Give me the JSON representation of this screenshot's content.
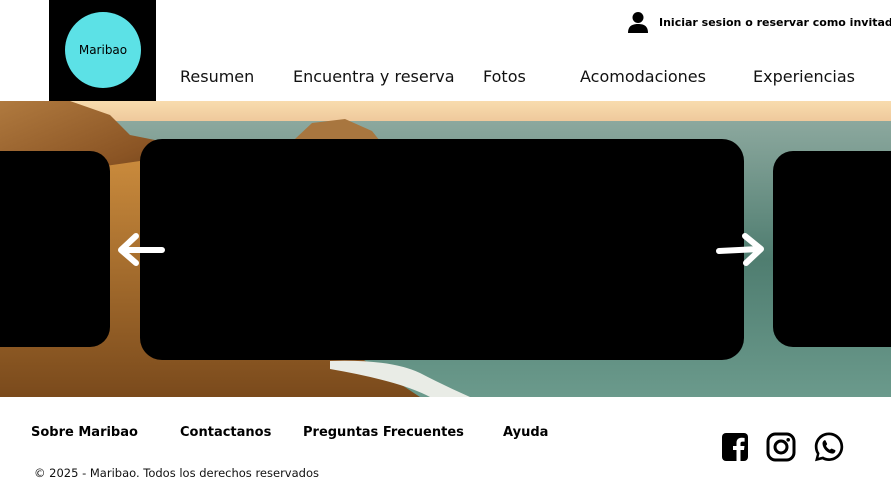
{
  "header": {
    "logo_text": "Maribao",
    "login_label": "Iniciar sesion o reservar como invitado",
    "nav": [
      {
        "label": "Resumen"
      },
      {
        "label": "Encuentra y reserva"
      },
      {
        "label": "Fotos"
      },
      {
        "label": "Acomodaciones"
      },
      {
        "label": "Experiencias"
      }
    ]
  },
  "carousel": {
    "prev_icon": "arrow-left-icon",
    "next_icon": "arrow-right-icon"
  },
  "footer": {
    "links": [
      {
        "label": "Sobre Maribao"
      },
      {
        "label": "Contactanos"
      },
      {
        "label": "Preguntas Frecuentes"
      },
      {
        "label": "Ayuda"
      }
    ],
    "copyright": "© 2025 - Maribao. Todos los derechos reservados",
    "social": [
      "facebook-icon",
      "instagram-icon",
      "whatsapp-icon"
    ]
  },
  "colors": {
    "logo_circle": "#5ce1e6",
    "logo_box": "#000000",
    "card": "#000000"
  }
}
